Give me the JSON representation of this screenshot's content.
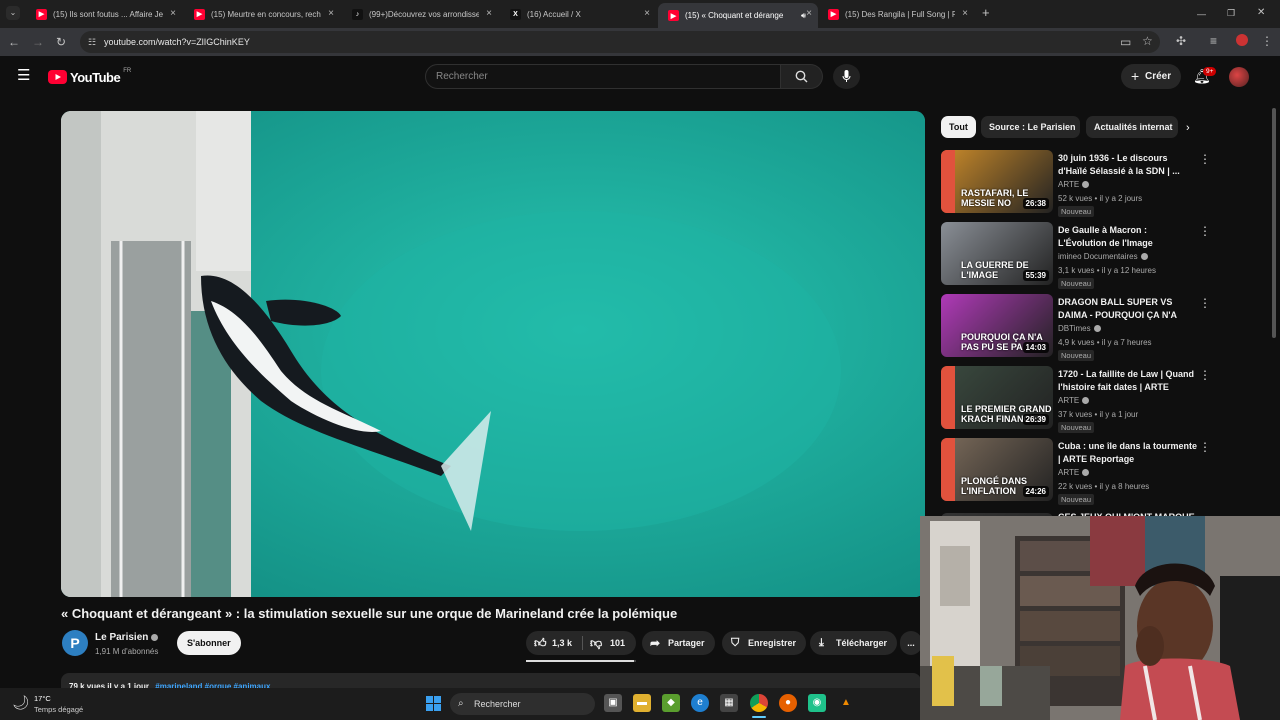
{
  "browser": {
    "tabs": [
      {
        "title": "(15) Ils sont foutus ... Affaire Jea",
        "icon": "youtube-icon"
      },
      {
        "title": "(15) Meurtre en concours, rech",
        "icon": "youtube-icon"
      },
      {
        "title": "(99+)Découvrez vos arrondisse",
        "icon": "tiktok-icon"
      },
      {
        "title": "(16) Accueil / X",
        "icon": "x-icon"
      },
      {
        "title": "(15) « Choquant et dérange",
        "icon": "youtube-icon",
        "active": true
      },
      {
        "title": "(15) Des Rangila | Full Song | Fa",
        "icon": "youtube-icon"
      }
    ],
    "new_tab": "+",
    "url": "youtube.com/watch?v=ZlIGChinKEY"
  },
  "youtube": {
    "logo": "YouTube",
    "country": "FR",
    "search_placeholder": "Rechercher",
    "create_label": "Créer",
    "notifications": "9+"
  },
  "video": {
    "title": "« Choquant et dérangeant » : la stimulation sexuelle sur une orque de Marineland crée la polémique",
    "channel": "Le Parisien",
    "subscribers": "1,91 M d'abonnés",
    "subscribe_label": "S'abonner",
    "likes": "1,3 k",
    "dislikes": "101",
    "share_label": "Partager",
    "save_label": "Enregistrer",
    "download_label": "Télécharger",
    "more_label": "...",
    "desc_views": "79 k vues  il y a 1 jour",
    "desc_tags": "#marineland #orque #animaux"
  },
  "sidebar": {
    "chips": [
      "Tout",
      "Source : Le Parisien",
      "Actualités internat"
    ],
    "recommendations": [
      {
        "title": "30 juin 1936 - Le discours d'Haïlé Sélassié à la SDN | ...",
        "channel": "ARTE",
        "meta": "52 k vues • il y a 2 jours",
        "badge": "Nouveau",
        "duration": "26:38",
        "thumb_text": "RASTAFARI, LE MESSIE NO",
        "thumb_color": "#c98a2a"
      },
      {
        "title": "De Gaulle à Macron : L'Évolution de l'Image Présidentielle",
        "channel": "imineo Documentaires",
        "meta": "3,1 k vues • il y a 12 heures",
        "badge": "Nouveau",
        "duration": "55:39",
        "thumb_text": "LA GUERRE DE L'IMAGE",
        "thumb_color": "#8a8f96"
      },
      {
        "title": "DRAGON BALL SUPER VS DAIMA - POURQUOI ÇA N'A PA...",
        "channel": "DBTimes",
        "meta": "4,9 k vues • il y a 7 heures",
        "badge": "Nouveau",
        "duration": "14:03",
        "thumb_text": "POURQUOI ÇA N'A PAS PU SE PA",
        "thumb_color": "#b03ab8"
      },
      {
        "title": "1720 - La faillite de Law | Quand l'histoire fait dates | ARTE",
        "channel": "ARTE",
        "meta": "37 k vues • il y a 1 jour",
        "badge": "Nouveau",
        "duration": "26:39",
        "thumb_text": "LE PREMIER GRAND KRACH FINANCIER",
        "thumb_color": "#3a4a3f"
      },
      {
        "title": "Cuba : une île dans la tourmente | ARTE Reportage",
        "channel": "ARTE",
        "meta": "22 k vues • il y a 8 heures",
        "badge": "Nouveau",
        "duration": "24:26",
        "thumb_text": "PLONGÉ DANS L'INFLATION",
        "thumb_color": "#7a6a5a"
      },
      {
        "title": "CES JEUX QUI M'ONT MARQUÉ",
        "channel": "",
        "meta": "",
        "badge": "",
        "duration": "",
        "thumb_text": "",
        "thumb_color": "#333"
      }
    ]
  },
  "taskbar": {
    "weather_temp": "17°C",
    "weather_desc": "Temps dégagé",
    "search_label": "Rechercher"
  },
  "colors": {
    "youtube_red": "#ff0033",
    "accent": "#3ea6ff"
  }
}
